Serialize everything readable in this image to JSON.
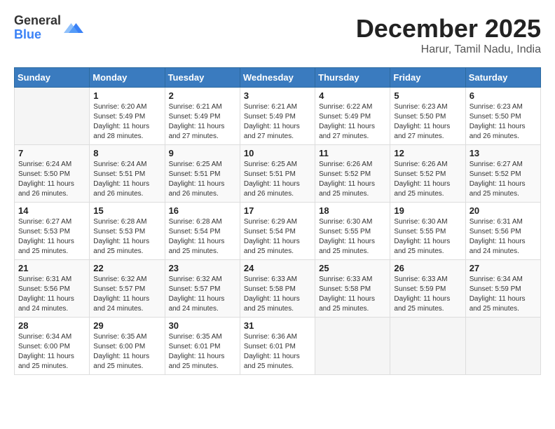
{
  "logo": {
    "general": "General",
    "blue": "Blue"
  },
  "title": {
    "month_year": "December 2025",
    "location": "Harur, Tamil Nadu, India"
  },
  "weekdays": [
    "Sunday",
    "Monday",
    "Tuesday",
    "Wednesday",
    "Thursday",
    "Friday",
    "Saturday"
  ],
  "weeks": [
    [
      {
        "day": "",
        "sunrise": "",
        "sunset": "",
        "daylight": ""
      },
      {
        "day": "1",
        "sunrise": "Sunrise: 6:20 AM",
        "sunset": "Sunset: 5:49 PM",
        "daylight": "Daylight: 11 hours and 28 minutes."
      },
      {
        "day": "2",
        "sunrise": "Sunrise: 6:21 AM",
        "sunset": "Sunset: 5:49 PM",
        "daylight": "Daylight: 11 hours and 27 minutes."
      },
      {
        "day": "3",
        "sunrise": "Sunrise: 6:21 AM",
        "sunset": "Sunset: 5:49 PM",
        "daylight": "Daylight: 11 hours and 27 minutes."
      },
      {
        "day": "4",
        "sunrise": "Sunrise: 6:22 AM",
        "sunset": "Sunset: 5:49 PM",
        "daylight": "Daylight: 11 hours and 27 minutes."
      },
      {
        "day": "5",
        "sunrise": "Sunrise: 6:23 AM",
        "sunset": "Sunset: 5:50 PM",
        "daylight": "Daylight: 11 hours and 27 minutes."
      },
      {
        "day": "6",
        "sunrise": "Sunrise: 6:23 AM",
        "sunset": "Sunset: 5:50 PM",
        "daylight": "Daylight: 11 hours and 26 minutes."
      }
    ],
    [
      {
        "day": "7",
        "sunrise": "Sunrise: 6:24 AM",
        "sunset": "Sunset: 5:50 PM",
        "daylight": "Daylight: 11 hours and 26 minutes."
      },
      {
        "day": "8",
        "sunrise": "Sunrise: 6:24 AM",
        "sunset": "Sunset: 5:51 PM",
        "daylight": "Daylight: 11 hours and 26 minutes."
      },
      {
        "day": "9",
        "sunrise": "Sunrise: 6:25 AM",
        "sunset": "Sunset: 5:51 PM",
        "daylight": "Daylight: 11 hours and 26 minutes."
      },
      {
        "day": "10",
        "sunrise": "Sunrise: 6:25 AM",
        "sunset": "Sunset: 5:51 PM",
        "daylight": "Daylight: 11 hours and 26 minutes."
      },
      {
        "day": "11",
        "sunrise": "Sunrise: 6:26 AM",
        "sunset": "Sunset: 5:52 PM",
        "daylight": "Daylight: 11 hours and 25 minutes."
      },
      {
        "day": "12",
        "sunrise": "Sunrise: 6:26 AM",
        "sunset": "Sunset: 5:52 PM",
        "daylight": "Daylight: 11 hours and 25 minutes."
      },
      {
        "day": "13",
        "sunrise": "Sunrise: 6:27 AM",
        "sunset": "Sunset: 5:52 PM",
        "daylight": "Daylight: 11 hours and 25 minutes."
      }
    ],
    [
      {
        "day": "14",
        "sunrise": "Sunrise: 6:27 AM",
        "sunset": "Sunset: 5:53 PM",
        "daylight": "Daylight: 11 hours and 25 minutes."
      },
      {
        "day": "15",
        "sunrise": "Sunrise: 6:28 AM",
        "sunset": "Sunset: 5:53 PM",
        "daylight": "Daylight: 11 hours and 25 minutes."
      },
      {
        "day": "16",
        "sunrise": "Sunrise: 6:28 AM",
        "sunset": "Sunset: 5:54 PM",
        "daylight": "Daylight: 11 hours and 25 minutes."
      },
      {
        "day": "17",
        "sunrise": "Sunrise: 6:29 AM",
        "sunset": "Sunset: 5:54 PM",
        "daylight": "Daylight: 11 hours and 25 minutes."
      },
      {
        "day": "18",
        "sunrise": "Sunrise: 6:30 AM",
        "sunset": "Sunset: 5:55 PM",
        "daylight": "Daylight: 11 hours and 25 minutes."
      },
      {
        "day": "19",
        "sunrise": "Sunrise: 6:30 AM",
        "sunset": "Sunset: 5:55 PM",
        "daylight": "Daylight: 11 hours and 25 minutes."
      },
      {
        "day": "20",
        "sunrise": "Sunrise: 6:31 AM",
        "sunset": "Sunset: 5:56 PM",
        "daylight": "Daylight: 11 hours and 24 minutes."
      }
    ],
    [
      {
        "day": "21",
        "sunrise": "Sunrise: 6:31 AM",
        "sunset": "Sunset: 5:56 PM",
        "daylight": "Daylight: 11 hours and 24 minutes."
      },
      {
        "day": "22",
        "sunrise": "Sunrise: 6:32 AM",
        "sunset": "Sunset: 5:57 PM",
        "daylight": "Daylight: 11 hours and 24 minutes."
      },
      {
        "day": "23",
        "sunrise": "Sunrise: 6:32 AM",
        "sunset": "Sunset: 5:57 PM",
        "daylight": "Daylight: 11 hours and 24 minutes."
      },
      {
        "day": "24",
        "sunrise": "Sunrise: 6:33 AM",
        "sunset": "Sunset: 5:58 PM",
        "daylight": "Daylight: 11 hours and 25 minutes."
      },
      {
        "day": "25",
        "sunrise": "Sunrise: 6:33 AM",
        "sunset": "Sunset: 5:58 PM",
        "daylight": "Daylight: 11 hours and 25 minutes."
      },
      {
        "day": "26",
        "sunrise": "Sunrise: 6:33 AM",
        "sunset": "Sunset: 5:59 PM",
        "daylight": "Daylight: 11 hours and 25 minutes."
      },
      {
        "day": "27",
        "sunrise": "Sunrise: 6:34 AM",
        "sunset": "Sunset: 5:59 PM",
        "daylight": "Daylight: 11 hours and 25 minutes."
      }
    ],
    [
      {
        "day": "28",
        "sunrise": "Sunrise: 6:34 AM",
        "sunset": "Sunset: 6:00 PM",
        "daylight": "Daylight: 11 hours and 25 minutes."
      },
      {
        "day": "29",
        "sunrise": "Sunrise: 6:35 AM",
        "sunset": "Sunset: 6:00 PM",
        "daylight": "Daylight: 11 hours and 25 minutes."
      },
      {
        "day": "30",
        "sunrise": "Sunrise: 6:35 AM",
        "sunset": "Sunset: 6:01 PM",
        "daylight": "Daylight: 11 hours and 25 minutes."
      },
      {
        "day": "31",
        "sunrise": "Sunrise: 6:36 AM",
        "sunset": "Sunset: 6:01 PM",
        "daylight": "Daylight: 11 hours and 25 minutes."
      },
      {
        "day": "",
        "sunrise": "",
        "sunset": "",
        "daylight": ""
      },
      {
        "day": "",
        "sunrise": "",
        "sunset": "",
        "daylight": ""
      },
      {
        "day": "",
        "sunrise": "",
        "sunset": "",
        "daylight": ""
      }
    ]
  ]
}
